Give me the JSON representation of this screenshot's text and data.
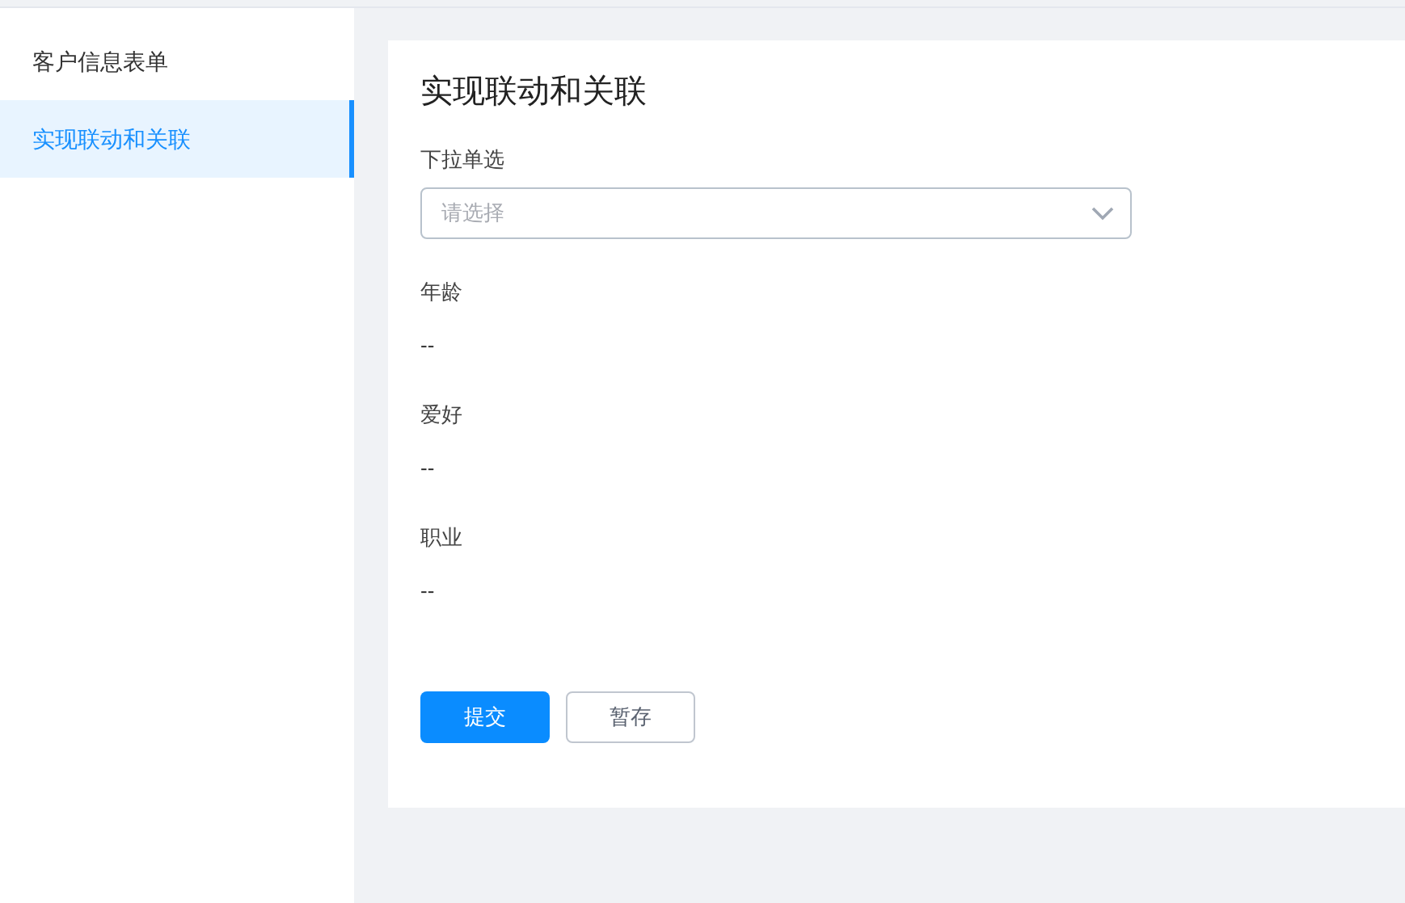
{
  "sidebar": {
    "items": [
      {
        "label": "客户信息表单",
        "selected": false
      },
      {
        "label": "实现联动和关联",
        "selected": true
      }
    ]
  },
  "form": {
    "title": "实现联动和关联",
    "select": {
      "label": "下拉单选",
      "placeholder": "请选择"
    },
    "fields": [
      {
        "label": "年龄",
        "value": "--"
      },
      {
        "label": "爱好",
        "value": "--"
      },
      {
        "label": "职业",
        "value": "--"
      }
    ],
    "buttons": [
      {
        "label": "提交",
        "kind": "primary"
      },
      {
        "label": "暂存",
        "kind": "default"
      }
    ]
  }
}
